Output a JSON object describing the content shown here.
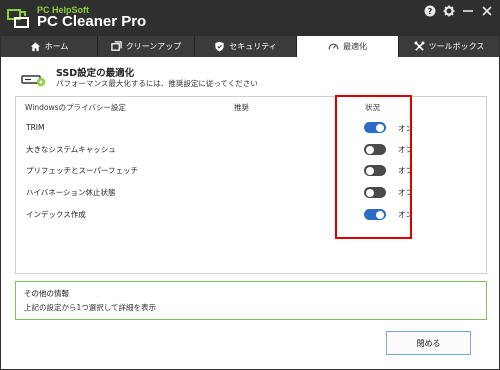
{
  "app": {
    "brand_top": "PC HelpSoft",
    "brand_main": "PC Cleaner Pro",
    "accent": "#8ccf3f"
  },
  "window_controls": [
    {
      "name": "help-icon"
    },
    {
      "name": "gear-icon"
    },
    {
      "name": "minimize-icon"
    },
    {
      "name": "close-icon"
    }
  ],
  "tabs": [
    {
      "label": "ホーム",
      "icon": "home-icon",
      "active": false
    },
    {
      "label": "クリーンアップ",
      "icon": "cleanup-icon",
      "active": false
    },
    {
      "label": "セキュリティ",
      "icon": "shield-icon",
      "active": false
    },
    {
      "label": "最適化",
      "icon": "speedometer-icon",
      "active": true
    },
    {
      "label": "ツールボックス",
      "icon": "tools-icon",
      "active": false
    }
  ],
  "header": {
    "title": "SSD設定の最適化",
    "subtitle": "パフォーマンス最大化するには、推奨設定に従ってください"
  },
  "table": {
    "columns": [
      "Windowsのプライバシー設定",
      "推奨",
      "状況"
    ],
    "rows": [
      {
        "label": "TRIM",
        "state": "on",
        "state_label": "オン"
      },
      {
        "label": "大きなシステムキャッシュ",
        "state": "off",
        "state_label": "オフ"
      },
      {
        "label": "プリフェッチとスーパーフェッチ",
        "state": "off",
        "state_label": "オフ"
      },
      {
        "label": "ハイバネーション休止状態",
        "state": "off",
        "state_label": "オフ"
      },
      {
        "label": "インデックス作成",
        "state": "on",
        "state_label": "オン"
      }
    ],
    "toggle_on_color": "#2b6cc4",
    "highlight_color": "#d80000"
  },
  "info": {
    "title": "その他の情報",
    "subtitle": "上記の設定から1つ選択して詳細を表示"
  },
  "footer": {
    "close_label": "閉める"
  }
}
